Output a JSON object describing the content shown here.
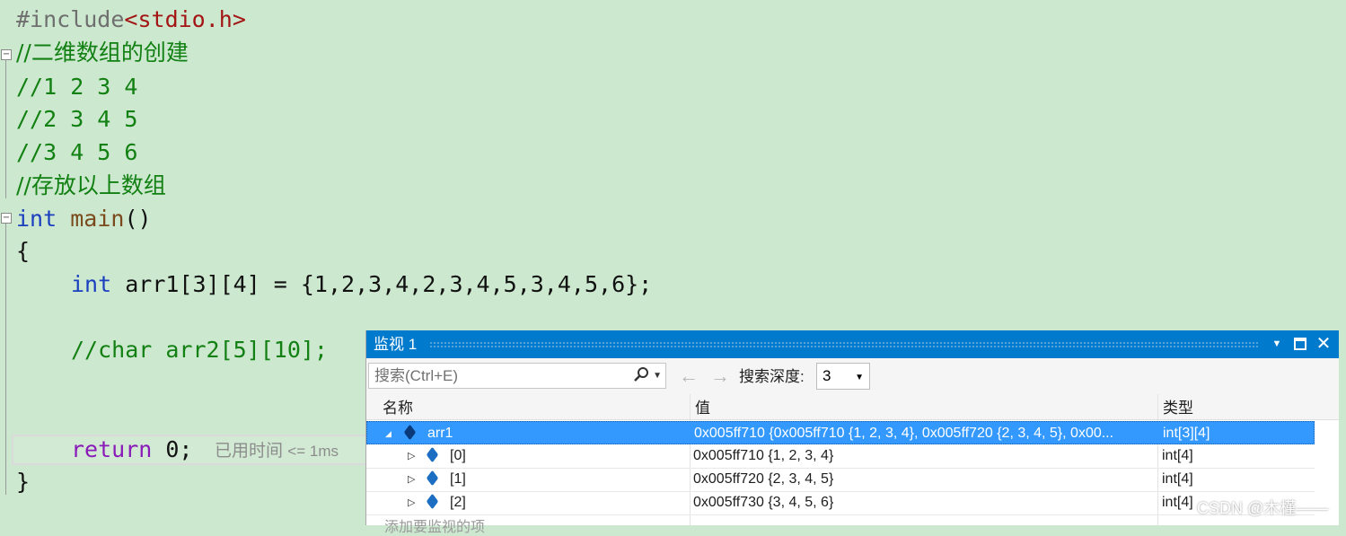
{
  "editor": {
    "include_directive": "#include",
    "include_header": "<stdio.h>",
    "comment_title": "//二维数组的创建",
    "comment_row1": "//1 2 3 4",
    "comment_row2": "//2 3 4 5",
    "comment_row3": "//3 4 5 6",
    "comment_store": "//存放以上数组",
    "main_kw": "int",
    "main_fn": "main",
    "main_parens": "()",
    "open_brace": "{",
    "decl_kw": "int",
    "decl_rest": "arr1[3][4] = {1,2,3,4,2,3,4,5,3,4,5,6};",
    "comment_char": "//char arr2[5][10];",
    "return_kw": "return",
    "return_rest": "0;",
    "perf_tip": "已用时间",
    "perf_value": "<= 1ms",
    "close_brace": "}"
  },
  "watch": {
    "title": "监视 1",
    "search_placeholder": "搜索(Ctrl+E)",
    "depth_label": "搜索深度:",
    "depth_value": "3",
    "columns": {
      "name": "名称",
      "value": "值",
      "type": "类型"
    },
    "rows": [
      {
        "name": "arr1",
        "value": "0x005ff710 {0x005ff710 {1, 2, 3, 4}, 0x005ff720 {2, 3, 4, 5}, 0x00...",
        "type": "int[3][4]",
        "expander": "◢"
      },
      {
        "name": "[0]",
        "value": "0x005ff710 {1, 2, 3, 4}",
        "type": "int[4]",
        "expander": "▷"
      },
      {
        "name": "[1]",
        "value": "0x005ff720 {2, 3, 4, 5}",
        "type": "int[4]",
        "expander": "▷"
      },
      {
        "name": "[2]",
        "value": "0x005ff730 {3, 4, 5, 6}",
        "type": "int[4]",
        "expander": "▷"
      }
    ],
    "add_item": "添加要监视的项"
  },
  "watermark": "CSDN @木槿——",
  "colors": {
    "background": "#cce8cf",
    "title_bar": "#007acc",
    "selection": "#3399ff",
    "keyword": "#1a3fbf",
    "comment": "#128012"
  }
}
